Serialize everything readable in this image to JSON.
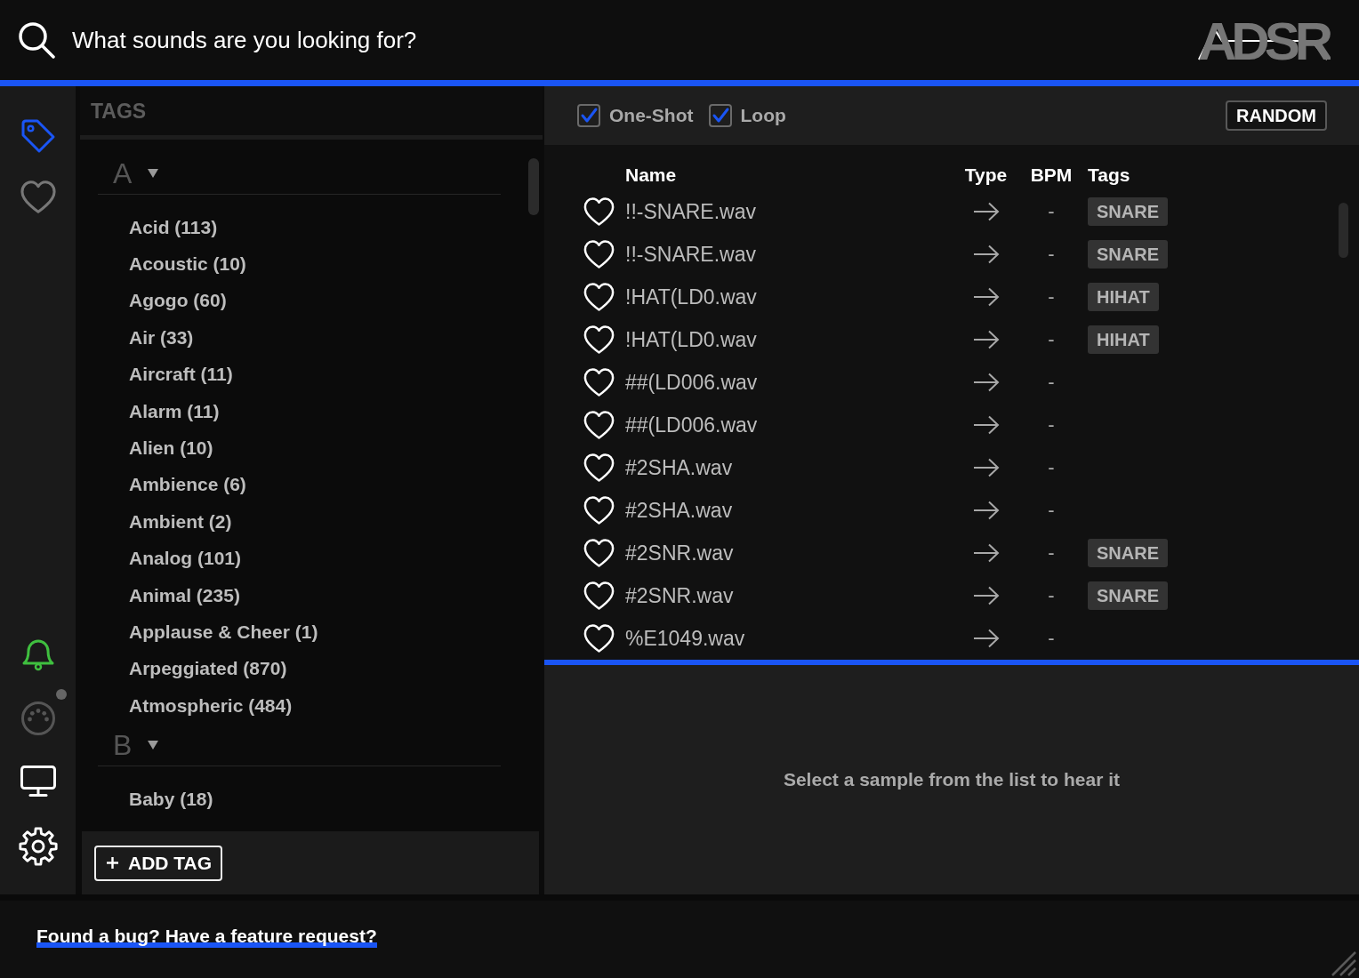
{
  "search": {
    "placeholder": "What sounds are you looking for?"
  },
  "logo": {
    "text": "ADSR"
  },
  "nav": [
    {
      "kind": "tags",
      "selected": true
    },
    {
      "kind": "favorites",
      "selected": false
    }
  ],
  "tools": [
    {
      "kind": "notifications"
    },
    {
      "kind": "midi"
    },
    {
      "kind": "display"
    },
    {
      "kind": "settings"
    }
  ],
  "tags_panel": {
    "title": "TAGS",
    "groups": [
      {
        "letter": "A",
        "expanded": true,
        "tags": [
          "Acid (113)",
          "Acoustic (10)",
          "Agogo (60)",
          "Air (33)",
          "Aircraft (11)",
          "Alarm (11)",
          "Alien (10)",
          "Ambience (6)",
          "Ambient (2)",
          "Analog (101)",
          "Animal (235)",
          "Applause & Cheer (1)",
          "Arpeggiated (870)",
          "Atmospheric (484)"
        ]
      },
      {
        "letter": "B",
        "expanded": true,
        "tags": [
          "Baby (18)"
        ]
      }
    ],
    "add_button": "ADD TAG"
  },
  "filters": [
    {
      "label": "One-Shot",
      "checked": true
    },
    {
      "label": "Loop",
      "checked": true
    }
  ],
  "random_button": "RANDOM",
  "table": {
    "columns": [
      "Name",
      "Type",
      "BPM",
      "Tags"
    ],
    "rows": [
      {
        "favorite": false,
        "name": "!!-SNARE.wav",
        "kind": "oneshot",
        "bpm": "-",
        "tags": [
          "SNARE"
        ]
      },
      {
        "favorite": false,
        "name": "!!-SNARE.wav",
        "kind": "oneshot",
        "bpm": "-",
        "tags": [
          "SNARE"
        ]
      },
      {
        "favorite": false,
        "name": "!HAT(LD0.wav",
        "kind": "oneshot",
        "bpm": "-",
        "tags": [
          "HIHAT"
        ]
      },
      {
        "favorite": false,
        "name": "!HAT(LD0.wav",
        "kind": "oneshot",
        "bpm": "-",
        "tags": [
          "HIHAT"
        ]
      },
      {
        "favorite": false,
        "name": "##(LD006.wav",
        "kind": "oneshot",
        "bpm": "-"
      },
      {
        "favorite": false,
        "name": "##(LD006.wav",
        "kind": "oneshot",
        "bpm": "-"
      },
      {
        "favorite": false,
        "name": "#2SHA.wav",
        "kind": "oneshot",
        "bpm": "-"
      },
      {
        "favorite": false,
        "name": "#2SHA.wav",
        "kind": "oneshot",
        "bpm": "-"
      },
      {
        "favorite": false,
        "name": "#2SNR.wav",
        "kind": "oneshot",
        "bpm": "-",
        "tags": [
          "SNARE"
        ]
      },
      {
        "favorite": false,
        "name": "#2SNR.wav",
        "kind": "oneshot",
        "bpm": "-",
        "tags": [
          "SNARE"
        ]
      },
      {
        "favorite": false,
        "name": "%E1049.wav",
        "kind": "oneshot",
        "bpm": "-"
      }
    ]
  },
  "player": {
    "message": "Select a sample from the list to hear it"
  },
  "footer": {
    "link": "Found a bug? Have a feature request?"
  }
}
